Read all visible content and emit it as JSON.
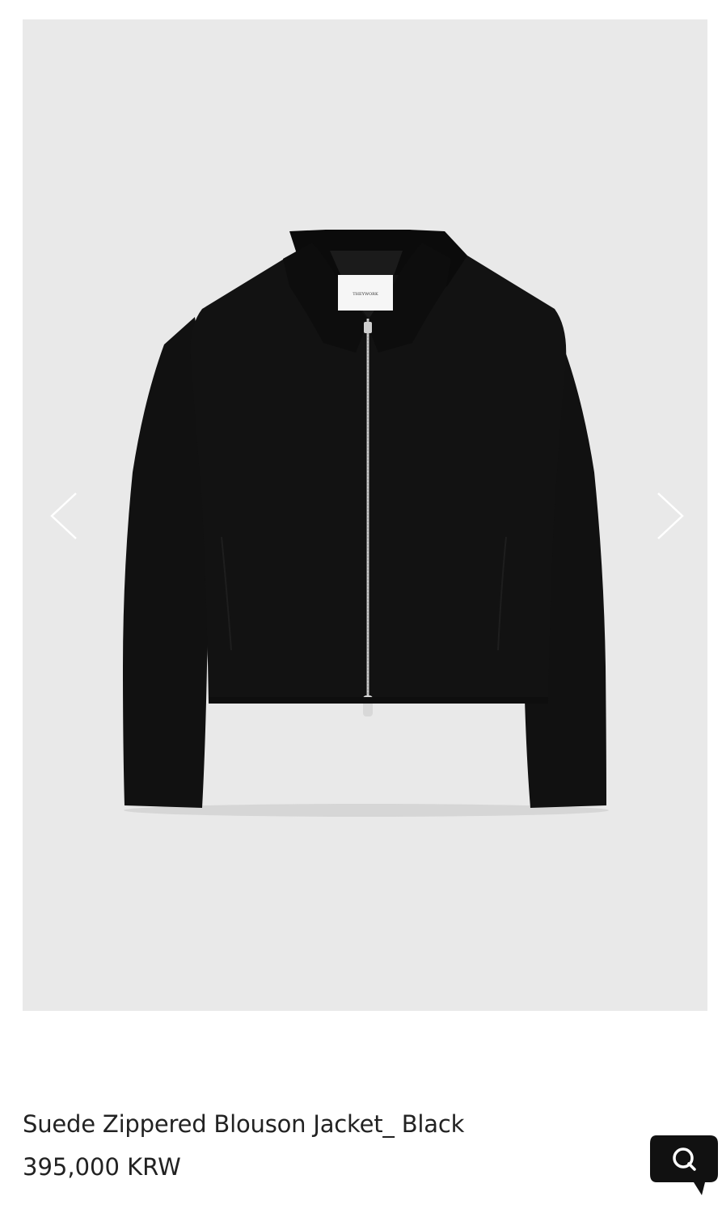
{
  "product": {
    "title": "Suede Zippered Blouson Jacket_ Black",
    "price": "395,000 KRW",
    "label_text": "THEYWORK"
  },
  "gallery": {
    "prev_icon": "chevron-left-icon",
    "next_icon": "chevron-right-icon",
    "background_color": "#e9e9e9"
  },
  "chat": {
    "icon": "search-chat-icon",
    "glyph": "Q",
    "color": "#111111"
  }
}
